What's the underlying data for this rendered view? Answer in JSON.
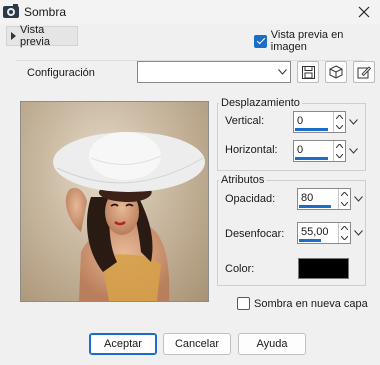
{
  "window": {
    "title": "Sombra",
    "close_icon": "close-icon",
    "app_icon": "paint-app-icon"
  },
  "preview": {
    "toggle_label": "Vista previa",
    "on_image_label": "Vista previa en imagen",
    "on_image_checked": true
  },
  "configuration": {
    "label": "Configuración",
    "preset_value": "",
    "tools": [
      "save-preset-icon",
      "reset-preset-icon",
      "manage-presets-icon"
    ]
  },
  "offset": {
    "title": "Desplazamiento",
    "vertical_label": "Vertical:",
    "vertical_value": "0",
    "horizontal_label": "Horizontal:",
    "horizontal_value": "0"
  },
  "attributes": {
    "title": "Atributos",
    "opacity_label": "Opacidad:",
    "opacity_value": "80",
    "opacity_fraction": 0.8,
    "blur_label": "Desenfocar:",
    "blur_value": "55,00",
    "blur_fraction": 0.55,
    "color_label": "Color:",
    "color_value": "#000000"
  },
  "shadow_on_new_layer": {
    "label": "Sombra en nueva capa",
    "checked": false
  },
  "buttons": {
    "ok": "Aceptar",
    "cancel": "Cancelar",
    "help": "Ayuda"
  },
  "colors": {
    "accent": "#1a6ec9",
    "dialog_bg": "#f0f0f0"
  }
}
